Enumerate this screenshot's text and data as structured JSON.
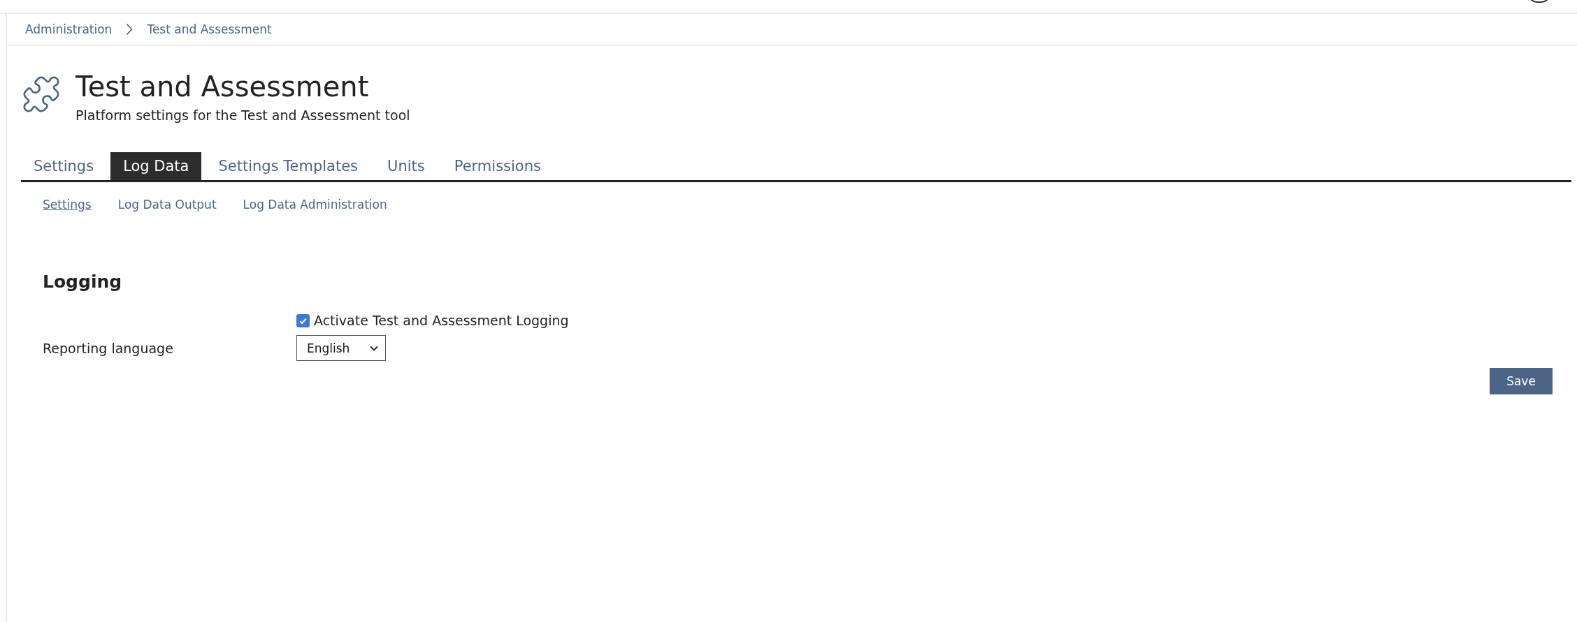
{
  "breadcrumbs": [
    "Administration",
    "Test and Assessment"
  ],
  "header": {
    "title": "Test and Assessment",
    "description": "Platform settings for the Test and Assessment tool"
  },
  "tabs": [
    {
      "label": "Settings",
      "selected": false
    },
    {
      "label": "Log Data",
      "selected": true
    },
    {
      "label": "Settings Templates",
      "selected": false
    },
    {
      "label": "Units",
      "selected": false
    },
    {
      "label": "Permissions",
      "selected": false
    }
  ],
  "subtabs": [
    {
      "label": "Settings",
      "selected": true
    },
    {
      "label": "Log Data Output",
      "selected": false
    },
    {
      "label": "Log Data Administration",
      "selected": false
    }
  ],
  "form": {
    "section_title": "Logging",
    "fields": [
      {
        "kind": "checkbox",
        "label": "Activate Test and Assessment Logging",
        "checked": true
      },
      {
        "kind": "select",
        "label": "Reporting language",
        "value": "English"
      }
    ],
    "buttons": [
      "Save"
    ]
  }
}
